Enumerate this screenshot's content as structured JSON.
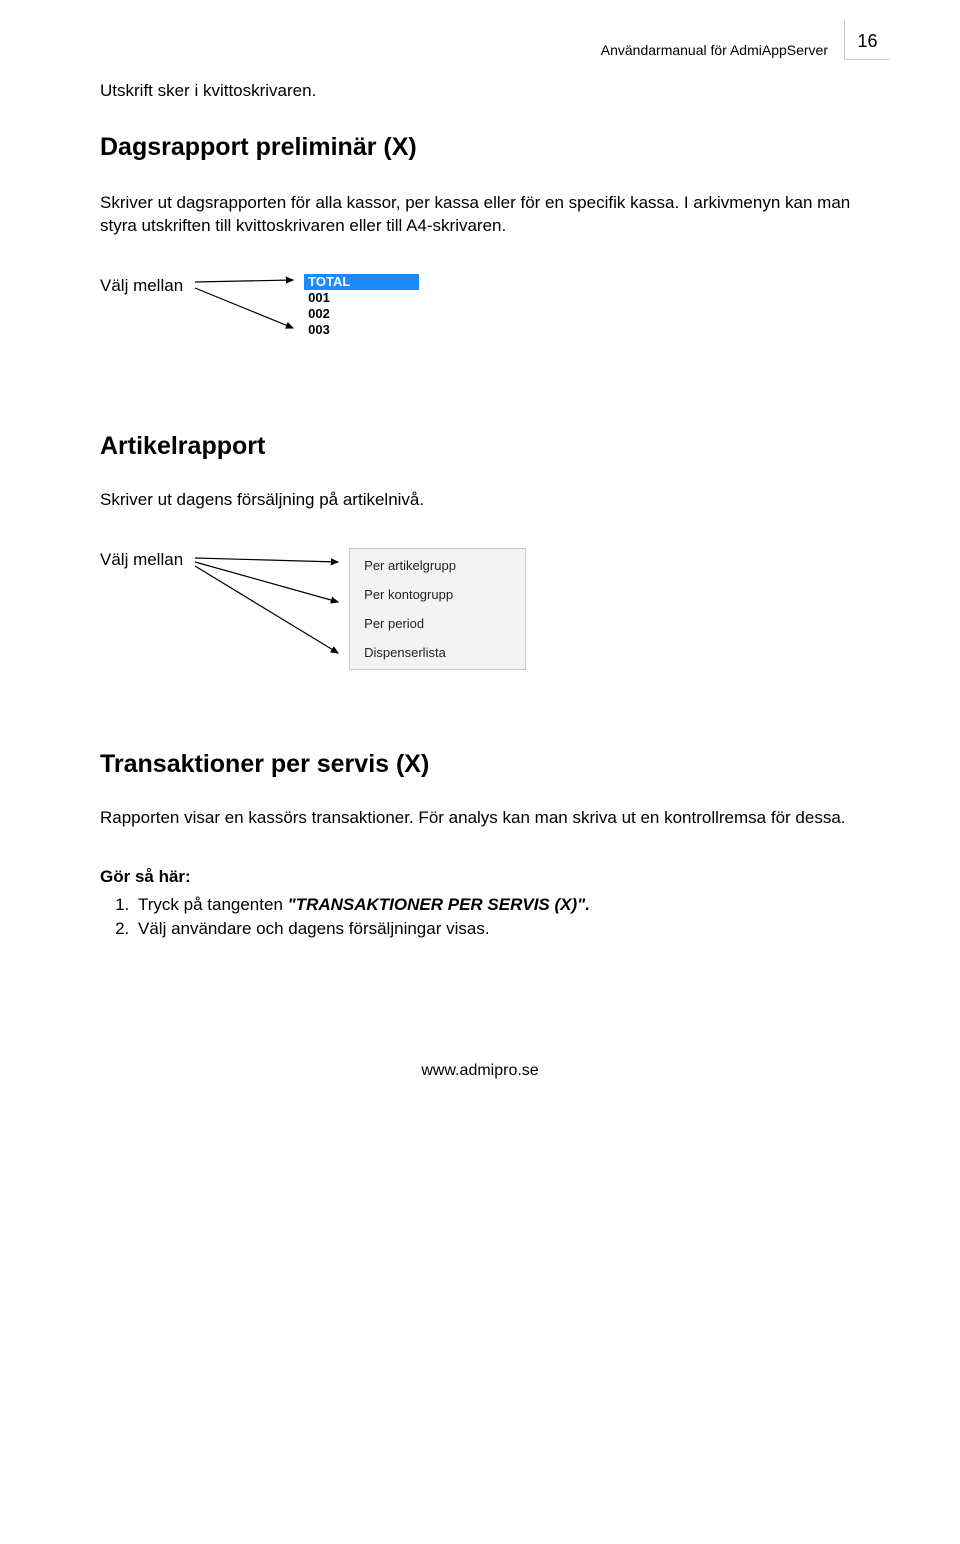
{
  "header": {
    "doc_title": "Användarmanual för AdmiAppServer",
    "page_number": "16"
  },
  "intro_line": "Utskrift sker i kvittoskrivaren.",
  "section1": {
    "title": "Dagsrapport preliminär (X)",
    "body": "Skriver ut dagsrapporten för alla kassor, per kassa eller för en specifik kassa. I arkivmenyn kan man styra utskriften till kvittoskrivaren eller till A4-skrivaren.",
    "pick_label": "Välj mellan",
    "list": {
      "selected": "TOTAL",
      "items": [
        "001",
        "002",
        "003"
      ]
    }
  },
  "section2": {
    "title": "Artikelrapport",
    "body": "Skriver ut dagens försäljning på artikelnivå.",
    "pick_label": "Välj mellan",
    "menu": [
      "Per artikelgrupp",
      "Per kontogrupp",
      "Per period",
      "Dispenserlista"
    ]
  },
  "section3": {
    "title": "Transaktioner per servis (X)",
    "body": "Rapporten visar en kassörs transaktioner. För analys kan man skriva ut en kontrollremsa för dessa.",
    "howto_label": "Gör så här:",
    "steps": {
      "s1_pre": "Tryck på tangenten ",
      "s1_key": "\"TRANSAKTIONER PER SERVIS (X)\".",
      "s2": "Välj användare och dagens försäljningar visas."
    }
  },
  "footer": "www.admipro.se"
}
